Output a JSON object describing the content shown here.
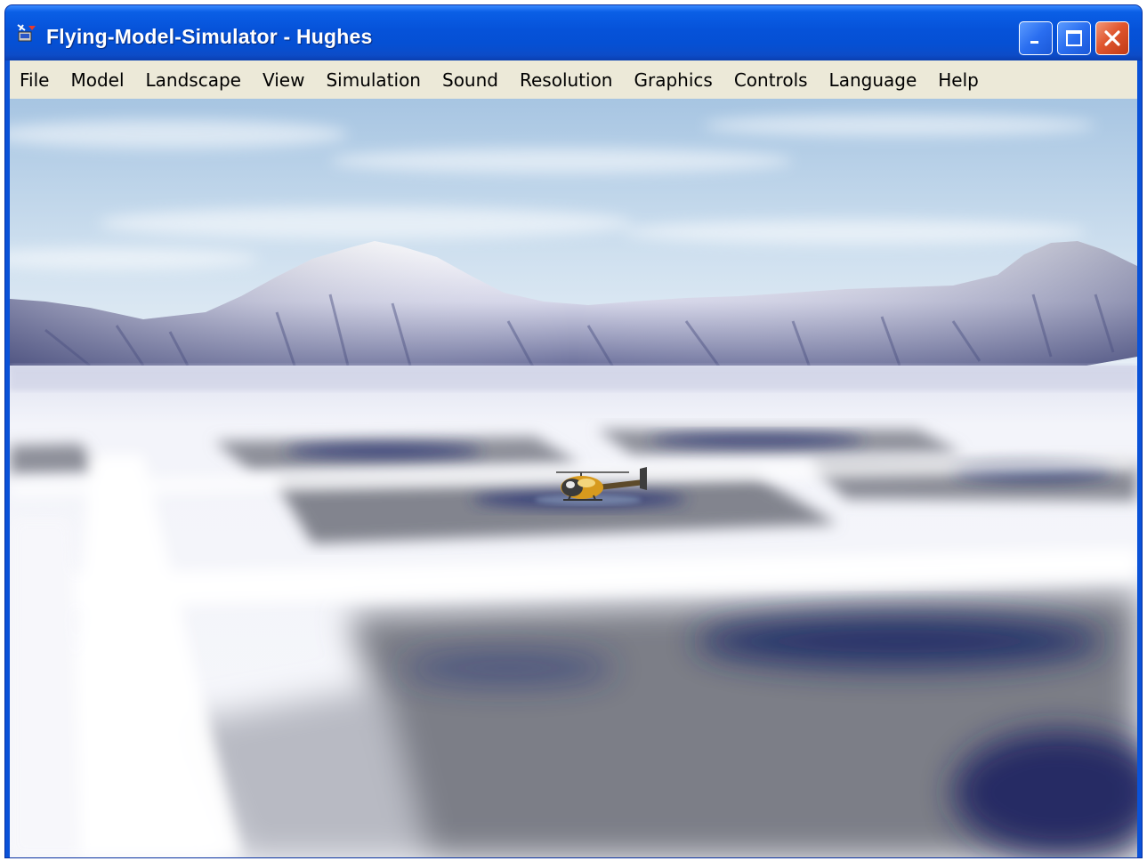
{
  "window": {
    "title": "Flying-Model-Simulator - Hughes",
    "controls": [
      "minimize",
      "maximize",
      "close"
    ]
  },
  "menu": {
    "items": [
      "File",
      "Model",
      "Landscape",
      "View",
      "Simulation",
      "Sound",
      "Resolution",
      "Graphics",
      "Controls",
      "Language",
      "Help"
    ]
  },
  "scene": {
    "description_icons": [
      "helicopter",
      "mountains",
      "snowfield"
    ],
    "colors": {
      "sky_top": "#a9c8e4",
      "sky_bottom": "#e8f0f6",
      "snow": "#eef0f8",
      "pad_dark": "#7c7e86",
      "shadow_blue": "#1f2a66"
    }
  },
  "theme": {
    "titlebar": "#0652d9",
    "menubar": "#ece9d8",
    "close_button": "#e0562e"
  }
}
